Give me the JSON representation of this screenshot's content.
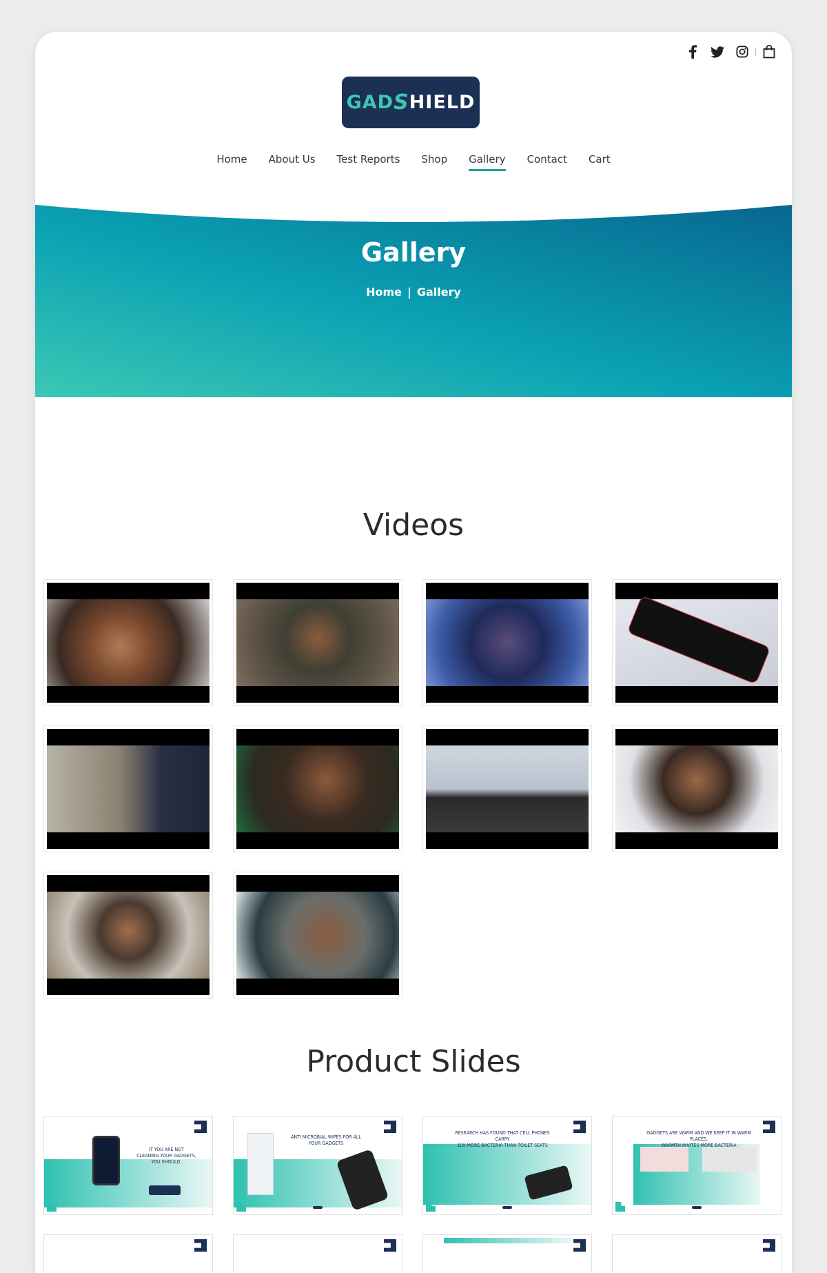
{
  "social": {
    "icons": [
      "facebook-icon",
      "twitter-icon",
      "instagram-icon",
      "shopping-bag-icon"
    ]
  },
  "logo": {
    "part1": "GAD",
    "part2": "S",
    "part3": "HIELD"
  },
  "nav": {
    "items": [
      {
        "label": "Home"
      },
      {
        "label": "About Us"
      },
      {
        "label": "Test Reports"
      },
      {
        "label": "Shop"
      },
      {
        "label": "Gallery",
        "active": true
      },
      {
        "label": "Contact"
      },
      {
        "label": "Cart"
      }
    ]
  },
  "hero": {
    "title": "Gallery",
    "breadcrumb": {
      "home": "Home",
      "separator": "|",
      "current": "Gallery"
    },
    "gradient": [
      "#3cc8b4",
      "#0aa2b4",
      "#08678f"
    ]
  },
  "videos": {
    "title": "Videos",
    "items": [
      {
        "scene": "closeup-face"
      },
      {
        "scene": "man-on-sofa"
      },
      {
        "scene": "man-drinking-night"
      },
      {
        "scene": "phone-with-germs"
      },
      {
        "scene": "man-with-laptop-couch"
      },
      {
        "scene": "man-with-glasses"
      },
      {
        "scene": "man-opening-laptop"
      },
      {
        "scene": "man-looking-at-phone"
      },
      {
        "scene": "man-smiling-living-room"
      },
      {
        "scene": "man-on-phone-call"
      }
    ]
  },
  "slides": {
    "title": "Product Slides",
    "items": [
      {
        "caption": "IT YOU ARE NOT\nCLEANING YOUR GADGETS,\nYOU SHOULD."
      },
      {
        "caption": "ANTI MICROBIAL WIPES FOR ALL YOUR GADGETS"
      },
      {
        "caption": "RESEARCH HAS FOUND THAT CELL PHONES CARRY\n10X MORE BACTERIA THAN TOILET SEATS"
      },
      {
        "caption": "GADGETS ARE WARM AND WE KEEP IT IN WARM PLACES,\nWARMTH INVITES MORE BACTERIA"
      }
    ]
  },
  "colors": {
    "accent": "#1aa59a",
    "navy": "#1c2f55",
    "teal": "#3cc6b5"
  }
}
